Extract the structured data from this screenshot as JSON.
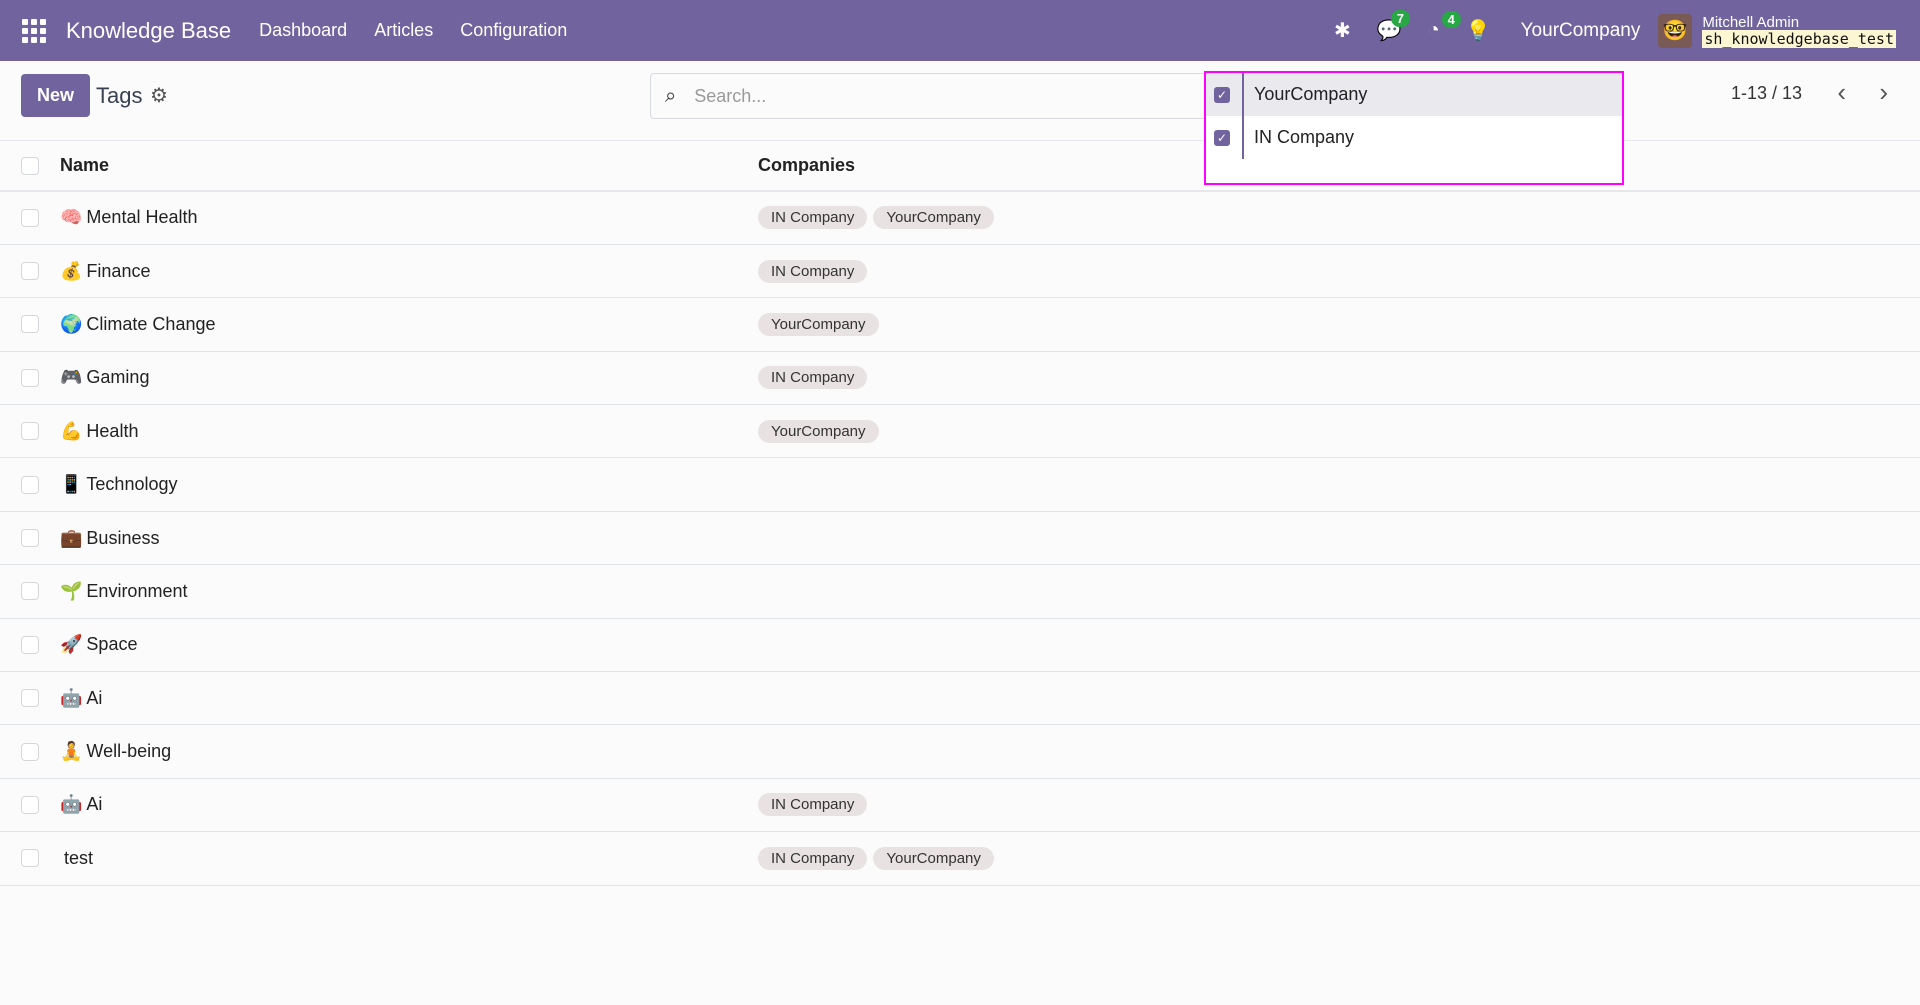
{
  "nav": {
    "brand": "Knowledge Base",
    "menu": [
      "Dashboard",
      "Articles",
      "Configuration"
    ],
    "messages_count": "7",
    "activities_count": "4",
    "company": "YourCompany",
    "user": "Mitchell Admin",
    "database": "sh_knowledgebase_test"
  },
  "control": {
    "new_label": "New",
    "title": "Tags",
    "search_placeholder": "Search...",
    "pager": "1-13 / 13"
  },
  "table": {
    "headers": [
      "Name",
      "Companies"
    ],
    "rows": [
      {
        "icon": "🧠",
        "name": "Mental Health",
        "companies": [
          "IN Company",
          "YourCompany"
        ]
      },
      {
        "icon": "💰",
        "name": "Finance",
        "companies": [
          "IN Company"
        ]
      },
      {
        "icon": "🌍",
        "name": "Climate Change",
        "companies": [
          "YourCompany"
        ]
      },
      {
        "icon": "🎮",
        "name": "Gaming",
        "companies": [
          "IN Company"
        ]
      },
      {
        "icon": "💪",
        "name": "Health",
        "companies": [
          "YourCompany"
        ]
      },
      {
        "icon": "📱",
        "name": "Technology",
        "companies": []
      },
      {
        "icon": "💼",
        "name": "Business",
        "companies": []
      },
      {
        "icon": "🌱",
        "name": "Environment",
        "companies": []
      },
      {
        "icon": "🚀",
        "name": "Space",
        "companies": []
      },
      {
        "icon": "🤖",
        "name": "Ai",
        "companies": []
      },
      {
        "icon": "🧘",
        "name": "Well-being",
        "companies": []
      },
      {
        "icon": "🤖",
        "name": "Ai",
        "companies": [
          "IN Company"
        ]
      },
      {
        "icon": "",
        "name": "test",
        "companies": [
          "IN Company",
          "YourCompany"
        ]
      }
    ]
  },
  "company_switcher": {
    "items": [
      {
        "label": "YourCompany",
        "checked": true
      },
      {
        "label": "IN Company",
        "checked": true
      }
    ]
  }
}
